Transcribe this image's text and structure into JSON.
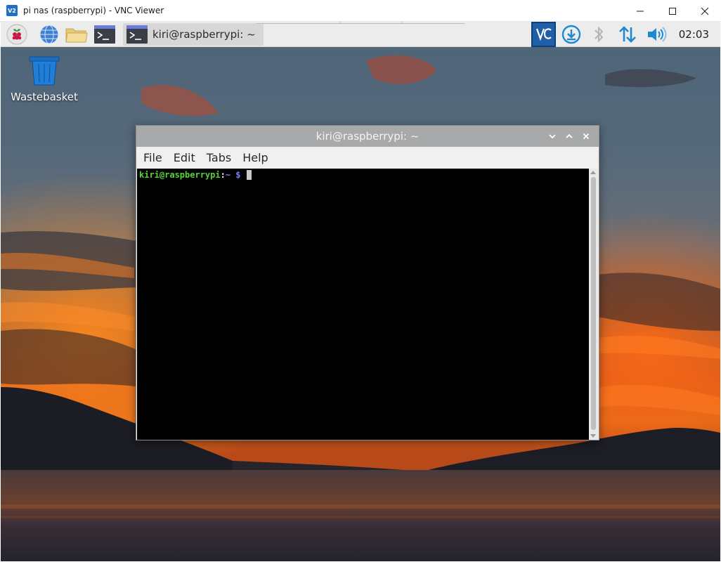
{
  "host_window": {
    "title": "pi nas (raspberrypi) - VNC Viewer",
    "app_icon_text": "V2"
  },
  "taskbar": {
    "window_button_label": "kiri@raspberrypi: ~",
    "clock": "02:03",
    "icons": [
      "raspberry-menu-icon",
      "web-browser-icon",
      "file-manager-icon",
      "terminal-icon",
      "vnc-server-icon",
      "download-icon",
      "bluetooth-icon",
      "network-icon",
      "volume-icon"
    ]
  },
  "desktop": {
    "icons": [
      {
        "label": "Wastebasket"
      }
    ]
  },
  "terminal": {
    "title": "kiri@raspberrypi: ~",
    "menu": [
      "File",
      "Edit",
      "Tabs",
      "Help"
    ],
    "prompt": {
      "user_host": "kiri@raspberrypi",
      "colon": ":",
      "path": "~",
      "symbol": " $ "
    }
  },
  "colors": {
    "prompt_green": "#56d13a",
    "prompt_blue": "#7d7dff",
    "vnc_accent": "#1e5fa8",
    "taskbar_bg": "#ececec"
  }
}
